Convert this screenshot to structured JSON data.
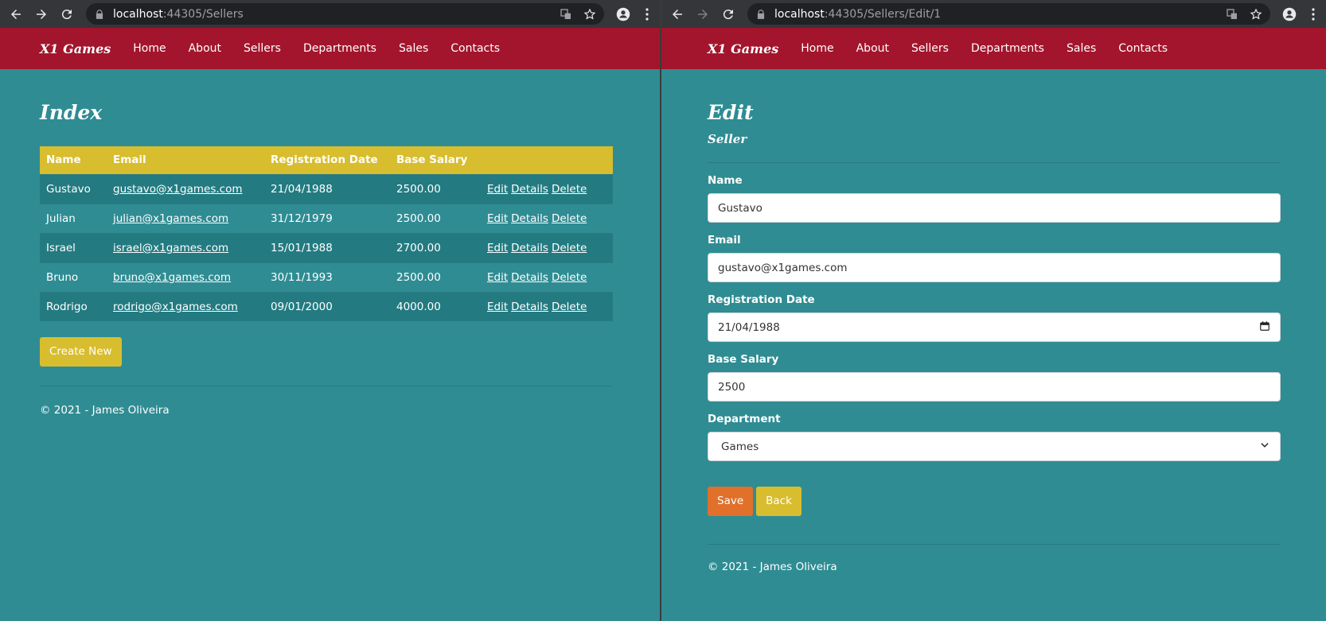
{
  "left": {
    "url": {
      "host": "localhost",
      "rest": ":44305/Sellers"
    },
    "brand": "X1 Games",
    "nav": [
      "Home",
      "About",
      "Sellers",
      "Departments",
      "Sales",
      "Contacts"
    ],
    "title": "Index",
    "table": {
      "headers": [
        "Name",
        "Email",
        "Registration Date",
        "Base Salary"
      ],
      "rows": [
        {
          "name": "Gustavo",
          "email": "gustavo@x1games.com",
          "date": "21/04/1988",
          "salary": "2500.00"
        },
        {
          "name": "Julian",
          "email": "julian@x1games.com",
          "date": "31/12/1979",
          "salary": "2500.00"
        },
        {
          "name": "Israel",
          "email": "israel@x1games.com",
          "date": "15/01/1988",
          "salary": "2700.00"
        },
        {
          "name": "Bruno",
          "email": "bruno@x1games.com",
          "date": "30/11/1993",
          "salary": "2500.00"
        },
        {
          "name": "Rodrigo",
          "email": "rodrigo@x1games.com",
          "date": "09/01/2000",
          "salary": "4000.00"
        }
      ],
      "actions": {
        "edit": "Edit",
        "details": "Details",
        "delete": "Delete"
      }
    },
    "create_label": "Create New",
    "footer": "© 2021 - James Oliveira"
  },
  "right": {
    "url": {
      "host": "localhost",
      "rest": ":44305/Sellers/Edit/1"
    },
    "brand": "X1 Games",
    "nav": [
      "Home",
      "About",
      "Sellers",
      "Departments",
      "Sales",
      "Contacts"
    ],
    "title": "Edit",
    "subtitle": "Seller",
    "form": {
      "name_label": "Name",
      "name_value": "Gustavo",
      "email_label": "Email",
      "email_value": "gustavo@x1games.com",
      "date_label": "Registration Date",
      "date_value": "21/04/1988",
      "salary_label": "Base Salary",
      "salary_value": "2500",
      "department_label": "Department",
      "department_value": "Games"
    },
    "save_label": "Save",
    "back_label": "Back",
    "footer": "© 2021 - James Oliveira"
  },
  "colors": {
    "navbar": "#a3152c",
    "background": "#2f8c93",
    "accent_yellow": "#d8bd2e",
    "accent_orange": "#e0702a"
  }
}
